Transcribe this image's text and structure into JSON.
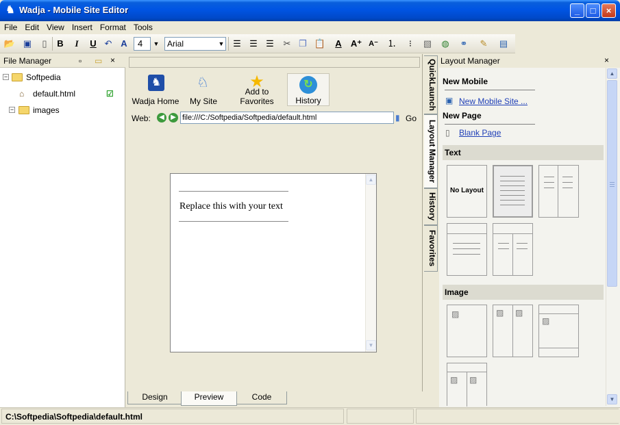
{
  "window": {
    "title": "Wadja - Mobile Site Editor",
    "minimize_label": "_",
    "maximize_label": "□",
    "close_label": "×"
  },
  "menu": [
    "File",
    "Edit",
    "View",
    "Insert",
    "Format",
    "Tools"
  ],
  "toolbar": {
    "font_size": "4",
    "font_name": "Arial",
    "bold": "B",
    "italic": "I",
    "underline": "U"
  },
  "file_manager": {
    "title": "File Manager",
    "tree": {
      "root": "Softpedia",
      "file": "default.html",
      "folder": "images"
    }
  },
  "quicklaunch": {
    "buttons": [
      "Wadja Home",
      "My Site",
      "Add to Favorites",
      "History"
    ],
    "web_label": "Web:",
    "url": "file:///C:/Softpedia/Softpedia/default.html",
    "go_label": "Go"
  },
  "editor": {
    "placeholder_text": "Replace this with your text",
    "tabs": [
      "Design",
      "Preview",
      "Code"
    ]
  },
  "side_tabs": [
    "QuickLaunch",
    "Layout Manager",
    "History",
    "Favorites"
  ],
  "layout_manager": {
    "title": "Layout Manager",
    "new_mobile_header": "New Mobile",
    "new_mobile_link": "New Mobile Site ...",
    "new_page_header": "New Page",
    "blank_page_link": "Blank Page",
    "text_section": "Text",
    "no_layout_label": "No Layout",
    "image_section": "Image"
  },
  "status": {
    "path": "C:\\Softpedia\\Softpedia\\default.html"
  },
  "colors": {
    "title_bar": "#0054e3",
    "link": "#1f3fb7",
    "panel_bg": "#ece9d8"
  }
}
